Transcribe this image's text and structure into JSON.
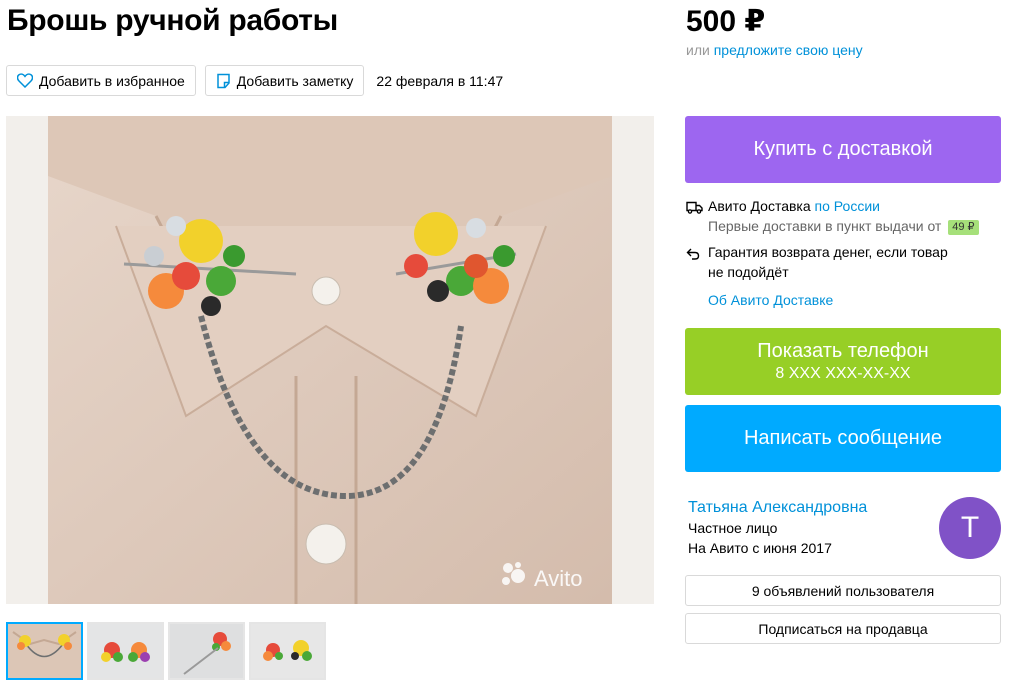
{
  "item": {
    "title": "Брошь ручной работы",
    "date": "22 февраля в 11:47",
    "price": "500 ₽",
    "offer_prefix": "или",
    "offer_link": "предложите свою цену"
  },
  "actions": {
    "favorite_label": "Добавить в избранное",
    "note_label": "Добавить заметку"
  },
  "gallery": {
    "watermark": "Avito",
    "thumbnail_count": 4,
    "active_index": 0
  },
  "buy": {
    "label": "Купить с доставкой"
  },
  "delivery": {
    "service": "Авито Доставка",
    "region_link": "по России",
    "first_delivery": "Первые доставки в пункт выдачи от",
    "fee": "49 ₽",
    "guarantee_line1": "Гарантия возврата денег, если товар",
    "guarantee_line2": "не подойдёт",
    "about_link": "Об Авито Доставке"
  },
  "contact": {
    "phone_label": "Показать телефон",
    "phone_number": "8 XXX XXX-XX-XX",
    "message_label": "Написать сообщение"
  },
  "seller": {
    "name": "Татьяна Александровна",
    "type": "Частное лицо",
    "since": "На Авито с июня 2017",
    "avatar_letter": "Т",
    "ads_button": "9 объявлений пользователя",
    "subscribe_button": "Подписаться на продавца"
  },
  "colors": {
    "buy": "#9d66f0",
    "phone": "#97cf26",
    "message": "#00aaff",
    "link": "#0091d9",
    "avatar": "#8052c7"
  }
}
